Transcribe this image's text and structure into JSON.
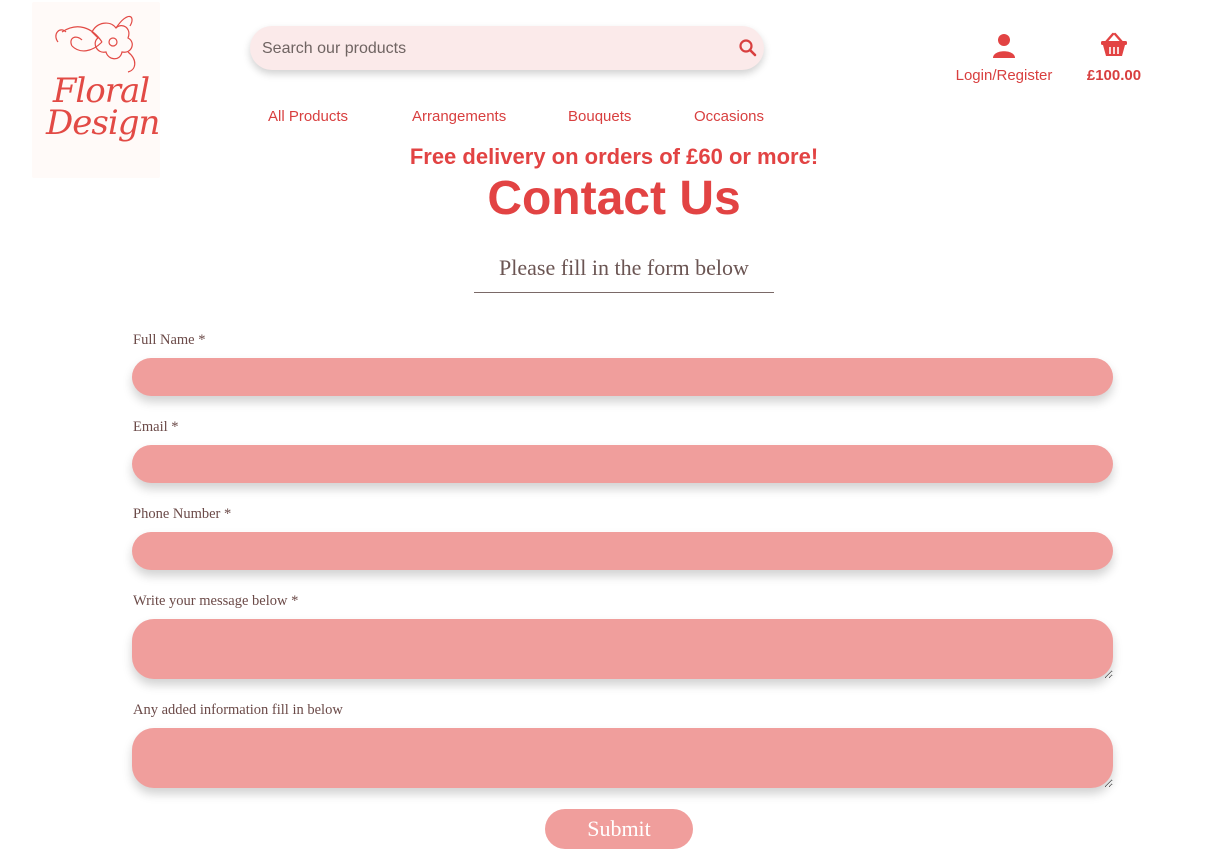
{
  "brand": {
    "logo_line1": "Floral",
    "logo_line2": "Design"
  },
  "search": {
    "placeholder": "Search our products"
  },
  "nav": {
    "items": [
      {
        "label": "All Products"
      },
      {
        "label": "Arrangements"
      },
      {
        "label": "Bouquets"
      },
      {
        "label": "Occasions"
      }
    ]
  },
  "account": {
    "label": "Login/Register"
  },
  "cart": {
    "total": "£100.00"
  },
  "promo": "Free delivery on orders of £60 or more!",
  "page": {
    "title": "Contact Us",
    "subtitle": "Please fill in the form below"
  },
  "form": {
    "full_name_label": "Full Name *",
    "email_label": "Email *",
    "phone_label": "Phone Number *",
    "message_label": "Write your message below *",
    "extra_label": "Any added information fill in below",
    "submit_label": "Submit"
  },
  "colors": {
    "accent": "#e24343",
    "field_bg": "#f09e9c",
    "search_bg": "#fbeaea"
  }
}
